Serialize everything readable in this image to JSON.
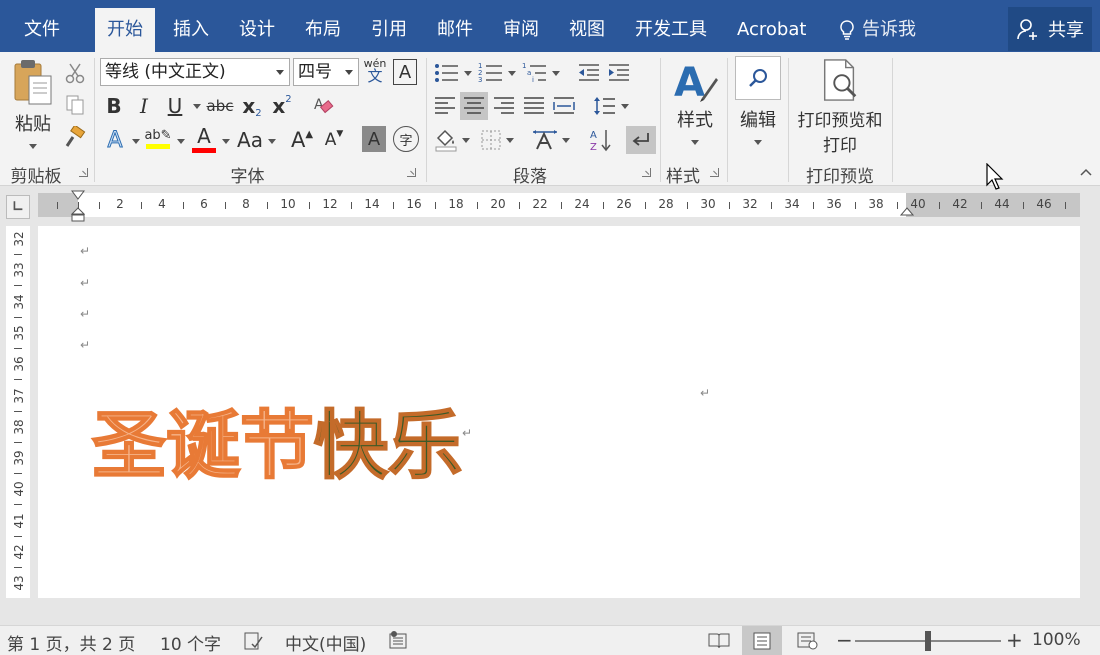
{
  "tabs": [
    {
      "label": "文件",
      "active": false
    },
    {
      "label": "开始",
      "active": true
    },
    {
      "label": "插入",
      "active": false
    },
    {
      "label": "设计",
      "active": false
    },
    {
      "label": "布局",
      "active": false
    },
    {
      "label": "引用",
      "active": false
    },
    {
      "label": "邮件",
      "active": false
    },
    {
      "label": "审阅",
      "active": false
    },
    {
      "label": "视图",
      "active": false
    },
    {
      "label": "开发工具",
      "active": false
    },
    {
      "label": "Acrobat",
      "active": false
    }
  ],
  "tell_me": "告诉我",
  "share": "共享",
  "ribbon": {
    "clipboard": {
      "paste_label": "粘贴",
      "group_label": "剪贴板"
    },
    "font": {
      "font_name": "等线 (中文正文)",
      "font_size": "四号",
      "phonetic_top": "wén",
      "phonetic_bottom": "文",
      "bold": "B",
      "italic": "I",
      "underline": "U",
      "strike": "abc",
      "subscript": "x",
      "superscript": "x",
      "change_case": "Aa",
      "grow": "A",
      "shrink": "A",
      "char_shading": "A",
      "enclose": "字",
      "group_label": "字体"
    },
    "paragraph": {
      "group_label": "段落"
    },
    "styles": {
      "label": "样式",
      "group_label": "样式"
    },
    "editing": {
      "label": "编辑"
    },
    "print_preview": {
      "label_line1": "打印预览和",
      "label_line2": "打印",
      "group_label": "打印预览"
    }
  },
  "ruler": {
    "numbers": [
      "2",
      "4",
      "6",
      "8",
      "10",
      "12",
      "14",
      "16",
      "18",
      "20",
      "22",
      "24",
      "26",
      "28",
      "30",
      "32",
      "34",
      "36",
      "38",
      "40",
      "42",
      "44",
      "46"
    ],
    "vertical_numbers": [
      "32",
      "33",
      "34",
      "35",
      "36",
      "37",
      "38",
      "39",
      "40",
      "41",
      "42",
      "43"
    ]
  },
  "document": {
    "heading_orange": "圣诞节",
    "heading_green": "快乐",
    "paragraph_mark": "↵"
  },
  "status": {
    "page": "第 1 页，共 2 页",
    "words": "10 个字",
    "language": "中文(中国)",
    "zoom": "100%",
    "zoom_minus": "−",
    "zoom_plus": "+"
  },
  "colors": {
    "tab_bar": "#2b579a",
    "highlight": "#ffff00",
    "font_color": "#ff0000",
    "heading_orange_fill": "#f6b48a",
    "heading_orange_stroke": "#e87a36",
    "heading_green_fill": "#3c5a27"
  }
}
